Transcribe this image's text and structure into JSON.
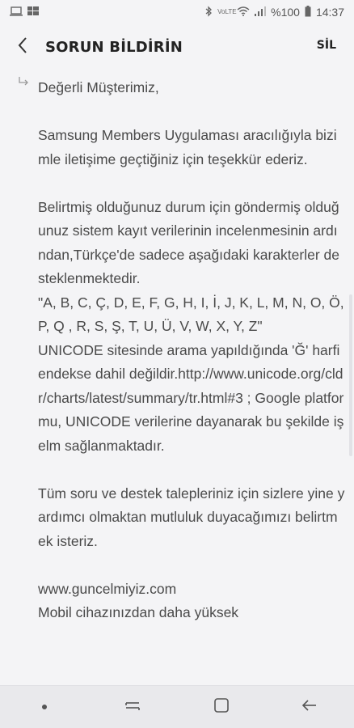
{
  "status_bar": {
    "battery": "%100",
    "time": "14:37",
    "network": "VoLTE"
  },
  "header": {
    "title": "SORUN BİLDİRİN",
    "delete_label": "SİL"
  },
  "message": {
    "body": "Değerli Müşterimiz,\n\nSamsung Members Uygulaması aracılığıyla bizimle iletişime geçtiğiniz için teşekkür ederiz.\n\nBelirtmiş olduğunuz durum için göndermiş olduğunuz sistem kayıt verilerinin incelenmesinin ardından,Türkçe'de sadece aşağıdaki karakterler desteklenmektedir.\n\"A, B, C, Ç, D, E, F, G, H, I, İ, J, K, L, M, N, O, Ö, P, Q , R, S, Ş, T, U, Ü, V, W, X, Y, Z\"\nUNICODE sitesinde arama yapıldığında 'Ğ' harfi endekse dahil değildir.http://www.unicode.org/cldr/charts/latest/summary/tr.html#3 ; Google platformu, UNICODE verilerine dayanarak bu şekilde işelm sağlanmaktadır.\n\nTüm soru ve destek talepleriniz için sizlere yine yardımcı olmaktan mutluluk duyacağımızı belirtmek isteriz.\n\nwww.guncelmiyiz.com\nMobil cihazınızdan daha yüksek"
  },
  "icons": {
    "back": "back-arrow-icon",
    "reply": "reply-arrow-icon"
  }
}
